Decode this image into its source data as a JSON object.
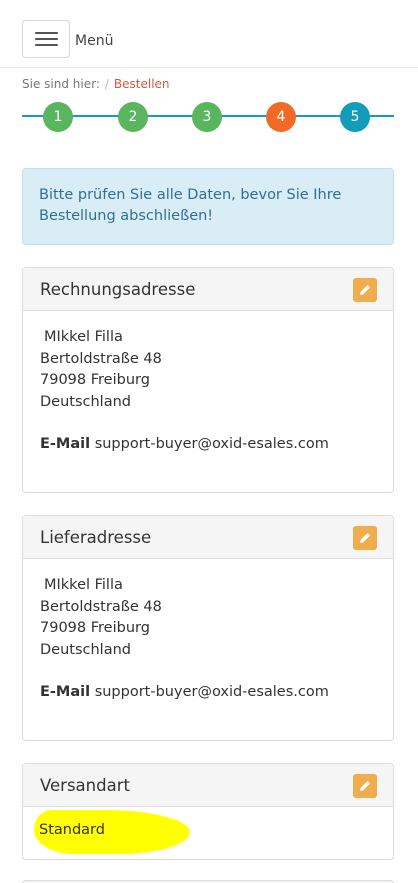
{
  "header": {
    "menu_label": "Menü"
  },
  "breadcrumb": {
    "prefix": "Sie sind hier:",
    "separator": "/",
    "current": "Bestellen"
  },
  "steps": [
    "1",
    "2",
    "3",
    "4",
    "5"
  ],
  "colors": {
    "step_done": "#59b65f",
    "step_current": "#f16b26",
    "step_next": "#139cba",
    "edit_button": "#f0ad4e"
  },
  "alert": {
    "text": "Bitte prüfen Sie alle Daten, bevor Sie Ihre Bestellung abschließen!"
  },
  "billing": {
    "title": "Rechnungsadresse",
    "name": "MIkkel Filla",
    "street": "Bertoldstraße 48",
    "city": "79098 Freiburg",
    "country": "Deutschland",
    "email_label": "E-Mail",
    "email": "support-buyer@oxid-esales.com"
  },
  "delivery": {
    "title": "Lieferadresse",
    "name": "MIkkel Filla",
    "street": "Bertoldstraße 48",
    "city": "79098 Freiburg",
    "country": "Deutschland",
    "email_label": "E-Mail",
    "email": "support-buyer@oxid-esales.com"
  },
  "shipping": {
    "title": "Versandart",
    "method": "Standard"
  },
  "icons": {
    "menu": "hamburger-icon",
    "edit": "pencil-icon"
  }
}
